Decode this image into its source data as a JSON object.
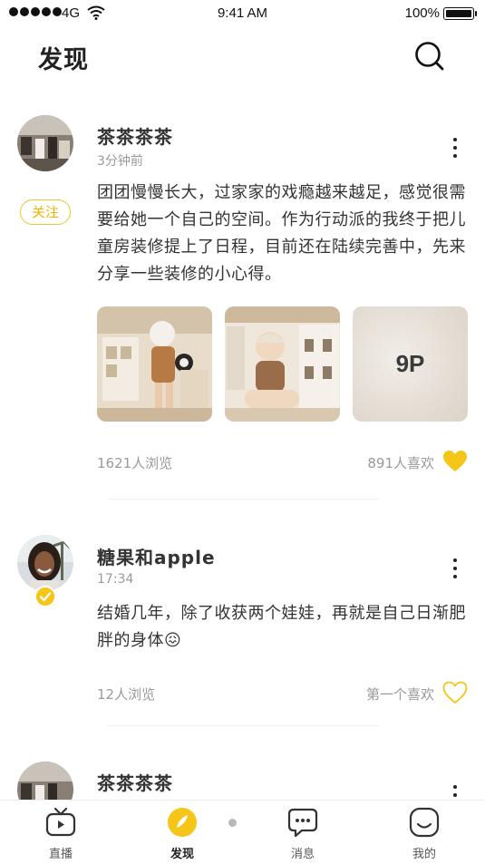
{
  "status_bar": {
    "carrier": "4G",
    "time": "9:41 AM",
    "battery": "100%"
  },
  "header": {
    "title": "发现",
    "search_icon": "search-icon"
  },
  "colors": {
    "accent": "#f5c518",
    "text_primary": "#333333",
    "text_secondary": "#9a9a9a"
  },
  "posts": [
    {
      "username": "茶茶茶茶",
      "time": "3分钟前",
      "follow_label": "关注",
      "text": "团团慢慢长大，过家家的戏瘾越来越足，感觉很需要给她一个自己的空间。作为行动派的我终于把儿童房装修提上了日程，目前还在陆续完善中，先来分享一些装修的小心得。",
      "photo_more_label": "9P",
      "views": "1621人浏览",
      "likes": "891人喜欢",
      "liked": true
    },
    {
      "username": "糖果和apple",
      "time": "17:34",
      "text": "结婚几年，除了收获两个娃娃，再就是自己日渐肥胖的身体😖",
      "views": "12人浏览",
      "likes": "第一个喜欢",
      "liked": false
    },
    {
      "username": "茶茶茶茶"
    }
  ],
  "tab_bar": {
    "items": [
      {
        "label": "直播",
        "icon": "tv-icon"
      },
      {
        "label": "发现",
        "icon": "discover-icon",
        "active": true
      },
      {
        "label": "消息",
        "icon": "message-icon"
      },
      {
        "label": "我的",
        "icon": "profile-icon"
      }
    ]
  }
}
